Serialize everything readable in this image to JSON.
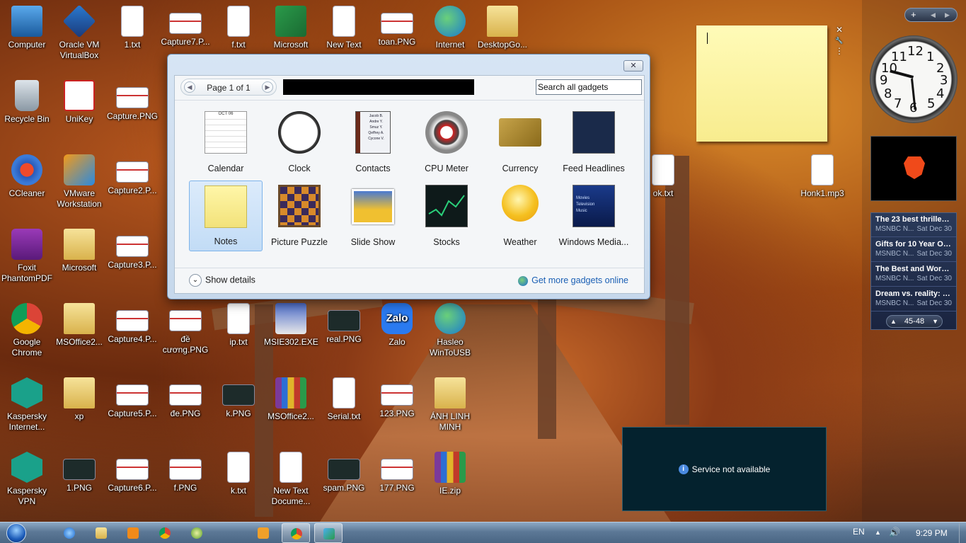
{
  "desktop": {
    "icons": [
      {
        "label": "Computer"
      },
      {
        "label": "Oracle VM VirtualBox"
      },
      {
        "label": "1.txt"
      },
      {
        "label": "Capture7.P..."
      },
      {
        "label": "f.txt"
      },
      {
        "label": "Microsoft"
      },
      {
        "label": "New Text"
      },
      {
        "label": "toan.PNG"
      },
      {
        "label": "Internet"
      },
      {
        "label": "DesktopGo..."
      },
      {
        "label": "Recycle Bin"
      },
      {
        "label": "UniKey"
      },
      {
        "label": "Capture.PNG"
      },
      {
        "label": "CCleaner"
      },
      {
        "label": "VMware Workstation"
      },
      {
        "label": "Capture2.P..."
      },
      {
        "label": "ok.txt"
      },
      {
        "label": "Honk1.mp3"
      },
      {
        "label": "Foxit PhantomPDF"
      },
      {
        "label": "Microsoft"
      },
      {
        "label": "Capture3.P..."
      },
      {
        "label": "Google Chrome"
      },
      {
        "label": "MSOffice2..."
      },
      {
        "label": "Capture4.P..."
      },
      {
        "label": "đề cương.PNG"
      },
      {
        "label": "ip.txt"
      },
      {
        "label": "MSIE302.EXE"
      },
      {
        "label": "real.PNG"
      },
      {
        "label": "Zalo"
      },
      {
        "label": "Hasleo WinToUSB"
      },
      {
        "label": "Kaspersky Internet..."
      },
      {
        "label": "xp"
      },
      {
        "label": "Capture5.P..."
      },
      {
        "label": "đe.PNG"
      },
      {
        "label": "k.PNG"
      },
      {
        "label": "MSOffice2..."
      },
      {
        "label": "Serial.txt"
      },
      {
        "label": "123.PNG"
      },
      {
        "label": "ÁNH LINH MINH"
      },
      {
        "label": "Kaspersky VPN"
      },
      {
        "label": "1.PNG"
      },
      {
        "label": "Capture6.P..."
      },
      {
        "label": "f.PNG"
      },
      {
        "label": "k.txt"
      },
      {
        "label": "New Text Docume..."
      },
      {
        "label": "spam.PNG"
      },
      {
        "label": "177.PNG"
      },
      {
        "label": "IE.zip"
      }
    ]
  },
  "gadget_window": {
    "close_label": "✕",
    "pager": {
      "prev": "◀",
      "text": "Page 1 of 1",
      "next": "▶"
    },
    "search_placeholder": "Search all gadgets",
    "gadgets": [
      {
        "label": "Calendar"
      },
      {
        "label": "Clock"
      },
      {
        "label": "Contacts"
      },
      {
        "label": "CPU Meter"
      },
      {
        "label": "Currency"
      },
      {
        "label": "Feed Headlines"
      },
      {
        "label": "Notes",
        "selected": true
      },
      {
        "label": "Picture Puzzle"
      },
      {
        "label": "Slide Show"
      },
      {
        "label": "Stocks"
      },
      {
        "label": "Weather"
      },
      {
        "label": "Windows Media..."
      }
    ],
    "calendar_month": "OCT 06",
    "contacts_names": [
      "Jacob B.",
      "Andre Y.",
      "Smuz Y.",
      "Qeffrey A.",
      "Cycone V."
    ],
    "wmc_items": [
      "Movies",
      "Television",
      "Music"
    ],
    "show_details": "Show details",
    "show_details_chevron": "⌄",
    "get_more": "Get more gadgets online"
  },
  "note_controls": {
    "close": "✕",
    "wrench": "🔧",
    "grip": "⋮"
  },
  "sidebar": {
    "add": "+",
    "prev": "◀",
    "next": "▶",
    "clock_numbers": [
      "12",
      "1",
      "2",
      "3",
      "4",
      "5",
      "6",
      "7",
      "8",
      "9",
      "10",
      "11"
    ],
    "news": [
      {
        "title": "The 23 best thriller b...",
        "source": "MSNBC N...",
        "date": "Sat Dec 30"
      },
      {
        "title": "Gifts for 10 Year Old ...",
        "source": "MSNBC N...",
        "date": "Sat Dec 30"
      },
      {
        "title": "The Best and Worst ...",
        "source": "MSNBC N...",
        "date": "Sat Dec 30"
      },
      {
        "title": "Dream vs. reality: W...",
        "source": "MSNBC N...",
        "date": "Sat Dec 30"
      }
    ],
    "news_pager": {
      "up": "▲",
      "text": "45-48",
      "down": "▼"
    }
  },
  "service": {
    "info": "i",
    "text": "Service not available"
  },
  "taskbar": {
    "language": "EN",
    "time": "9:29 PM",
    "tray_arrow": "▲",
    "volume": "🔊",
    "items": [
      "internet-explorer",
      "explorer",
      "media-player",
      "chrome",
      "ccleaner-task",
      "app-orange",
      "chrome-active",
      "gadgets-active"
    ]
  },
  "colors": {
    "link": "#1a5fb4",
    "selection": "#c2dcf6",
    "note": "#fdf3a0",
    "service_bg": "#04222e"
  }
}
